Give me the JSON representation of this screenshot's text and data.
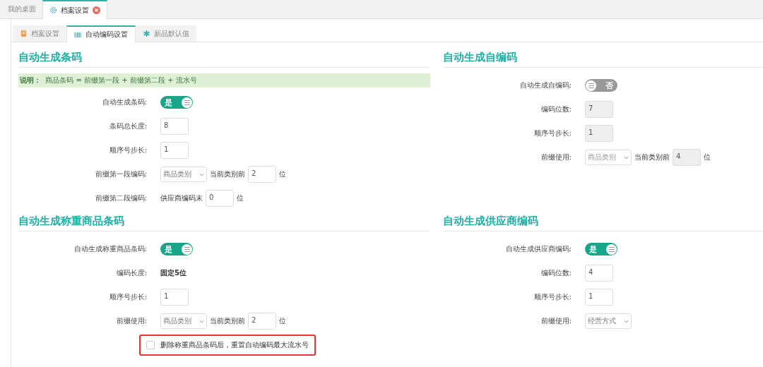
{
  "top_tabs": [
    {
      "label": "我的桌面",
      "selected": false,
      "closable": false
    },
    {
      "label": "档案设置",
      "selected": true,
      "closable": true
    }
  ],
  "sub_tabs": [
    {
      "label": "档案设置",
      "selected": false
    },
    {
      "label": "自动编码设置",
      "selected": true
    },
    {
      "label": "新品默认值",
      "selected": false
    }
  ],
  "sections": [
    {
      "title": "自动生成条码",
      "note_label": "说明：",
      "note": "商品条码 = 前缀第一段 + 前缀第二段 + 流水号",
      "rows": [
        {
          "kind": "toggle",
          "label": "自动生成条码:",
          "on": true,
          "text": "是"
        },
        {
          "kind": "input",
          "label": "条码总长度:",
          "value": "8",
          "disabled": false
        },
        {
          "kind": "input",
          "label": "顺序号步长:",
          "value": "1",
          "disabled": false
        },
        {
          "kind": "select_input",
          "label": "前缀第一段编码:",
          "select": "商品类别",
          "text": "当前类别前",
          "value": "2",
          "unit": "位",
          "disabled": false
        },
        {
          "kind": "text_input",
          "label": "前缀第二段编码:",
          "text": "供应商编码末",
          "value": "0",
          "unit": "位",
          "disabled": false
        }
      ]
    },
    {
      "title": "自动生成自编码",
      "rows": [
        {
          "kind": "toggle",
          "label": "自动生成自编码:",
          "on": false,
          "text": "否"
        },
        {
          "kind": "input",
          "label": "编码位数:",
          "value": "7",
          "disabled": true
        },
        {
          "kind": "input",
          "label": "顺序号步长:",
          "value": "1",
          "disabled": true
        },
        {
          "kind": "select_input",
          "label": "前缀使用:",
          "select": "商品类别",
          "text": "当前类别前",
          "value": "4",
          "unit": "位",
          "disabled": true
        }
      ]
    },
    {
      "title": "自动生成称重商品条码",
      "rows": [
        {
          "kind": "toggle",
          "label": "自动生成称重商品条码:",
          "on": true,
          "text": "是"
        },
        {
          "kind": "static",
          "label": "编码长度:",
          "value": "固定5位"
        },
        {
          "kind": "input",
          "label": "顺序号步长:",
          "value": "1",
          "disabled": false
        },
        {
          "kind": "select_input",
          "label": "前缀使用:",
          "select": "商品类别",
          "text": "当前类别前",
          "value": "2",
          "unit": "位",
          "disabled": false
        },
        {
          "kind": "checkbox",
          "label": "删除称重商品条码后，重置自动编码最大流水号",
          "checked": false,
          "highlighted": true
        }
      ]
    },
    {
      "title": "自动生成供应商编码",
      "rows": [
        {
          "kind": "toggle",
          "label": "自动生成供应商编码:",
          "on": true,
          "text": "是"
        },
        {
          "kind": "input",
          "label": "编码位数:",
          "value": "4",
          "disabled": false
        },
        {
          "kind": "input",
          "label": "顺序号步长:",
          "value": "1",
          "disabled": false
        },
        {
          "kind": "select",
          "label": "前缀使用:",
          "select": "经营方式",
          "disabled": false
        }
      ]
    }
  ]
}
